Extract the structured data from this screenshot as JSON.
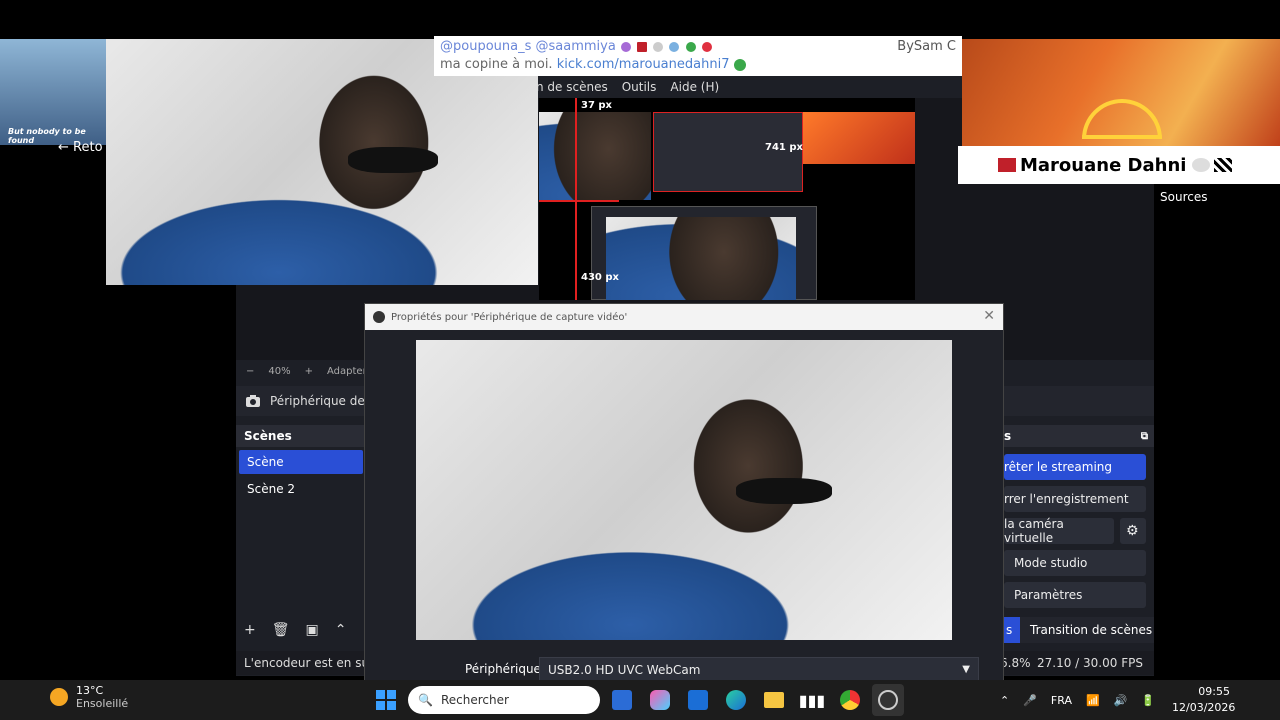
{
  "obs": {
    "menu": [
      "n de scènes",
      "Outils",
      "Aide (H)"
    ],
    "back_label": "Reto",
    "sources_label": "Sources",
    "zoom": {
      "level": "40%",
      "fit_label": "Adapter à"
    },
    "source_bar_label": "Périphérique de ca",
    "scenes": {
      "title": "Scènes",
      "items": [
        "Scène",
        "Scène 2"
      ]
    },
    "controls": {
      "title": "s",
      "stop_streaming": "rêter le streaming",
      "start_recording": "rrer l'enregistrement",
      "virtual_camera": "la caméra virtuelle",
      "studio_mode": "Mode studio",
      "settings": "Paramètres"
    },
    "transition": {
      "left": "s",
      "label": "Transition de scènes"
    },
    "status": {
      "encoder": "L'encodeur est en surch",
      "cpu": "6.8%",
      "fps": "27.10 / 30.00 FPS"
    },
    "rulers": [
      "37 px",
      "741 px",
      "430 px"
    ]
  },
  "dialog": {
    "title": "Propriétés pour 'Périphérique de capture vidéo'",
    "device_label": "Périphérique",
    "device_value": "USB2.0 HD UVC WebCam"
  },
  "overlays": {
    "chat_handles": "@poupouna_s  @saammiya",
    "chat_suffix": "BySam C",
    "chat_text": "ma copine à moi.",
    "chat_link": "kick.com/marouanedahni7",
    "name_banner": "Marouane Dahni",
    "video_caption": "But nobody to be found"
  },
  "taskbar": {
    "weather_temp": "13°C",
    "weather_desc": "Ensoleillé",
    "search_placeholder": "Rechercher",
    "language": "FRA",
    "time": "09:55",
    "date": "12/03/2026"
  },
  "colors": {
    "accent": "#2a4fd6",
    "obs_bg": "#1d1f26",
    "dock_header": "#2a2c35"
  }
}
